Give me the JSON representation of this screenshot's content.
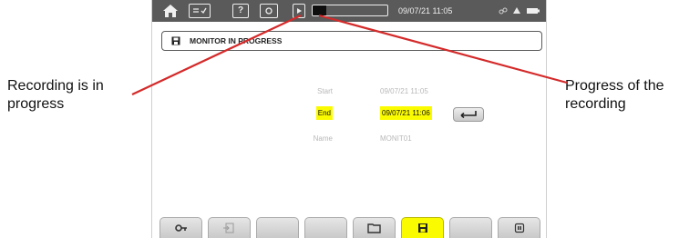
{
  "callouts": {
    "left": "Recording is in progress",
    "right": "Progress of the recording"
  },
  "status_bar": {
    "icons": [
      "home-icon",
      "configuration-icon",
      "help-icon",
      "camera-icon",
      "recording-icon",
      "battery-icon"
    ],
    "datetime": "09/07/21 11:05",
    "recording_progress": 0.18
  },
  "title": {
    "icon": "save-icon",
    "text": "MONITOR IN PROGRESS"
  },
  "form": {
    "start_label": "Start",
    "start_value": "09/07/21 11:05",
    "end_label": "End",
    "end_value": "09/07/21 11:06",
    "name_label": "Name",
    "name_value": "MONIT01"
  },
  "function_keys": [
    {
      "icon": "key-icon",
      "active": false
    },
    {
      "icon": "export-icon",
      "active": false
    },
    {
      "icon": "",
      "active": false
    },
    {
      "icon": "",
      "active": false
    },
    {
      "icon": "folder-icon",
      "active": false
    },
    {
      "icon": "save-icon",
      "active": true
    },
    {
      "icon": "",
      "active": false
    },
    {
      "icon": "stop-icon",
      "active": false
    }
  ],
  "colors": {
    "highlight": "#fbfb00",
    "status_bar": "#5a5a5a",
    "callout_line": "#d42a2a"
  }
}
